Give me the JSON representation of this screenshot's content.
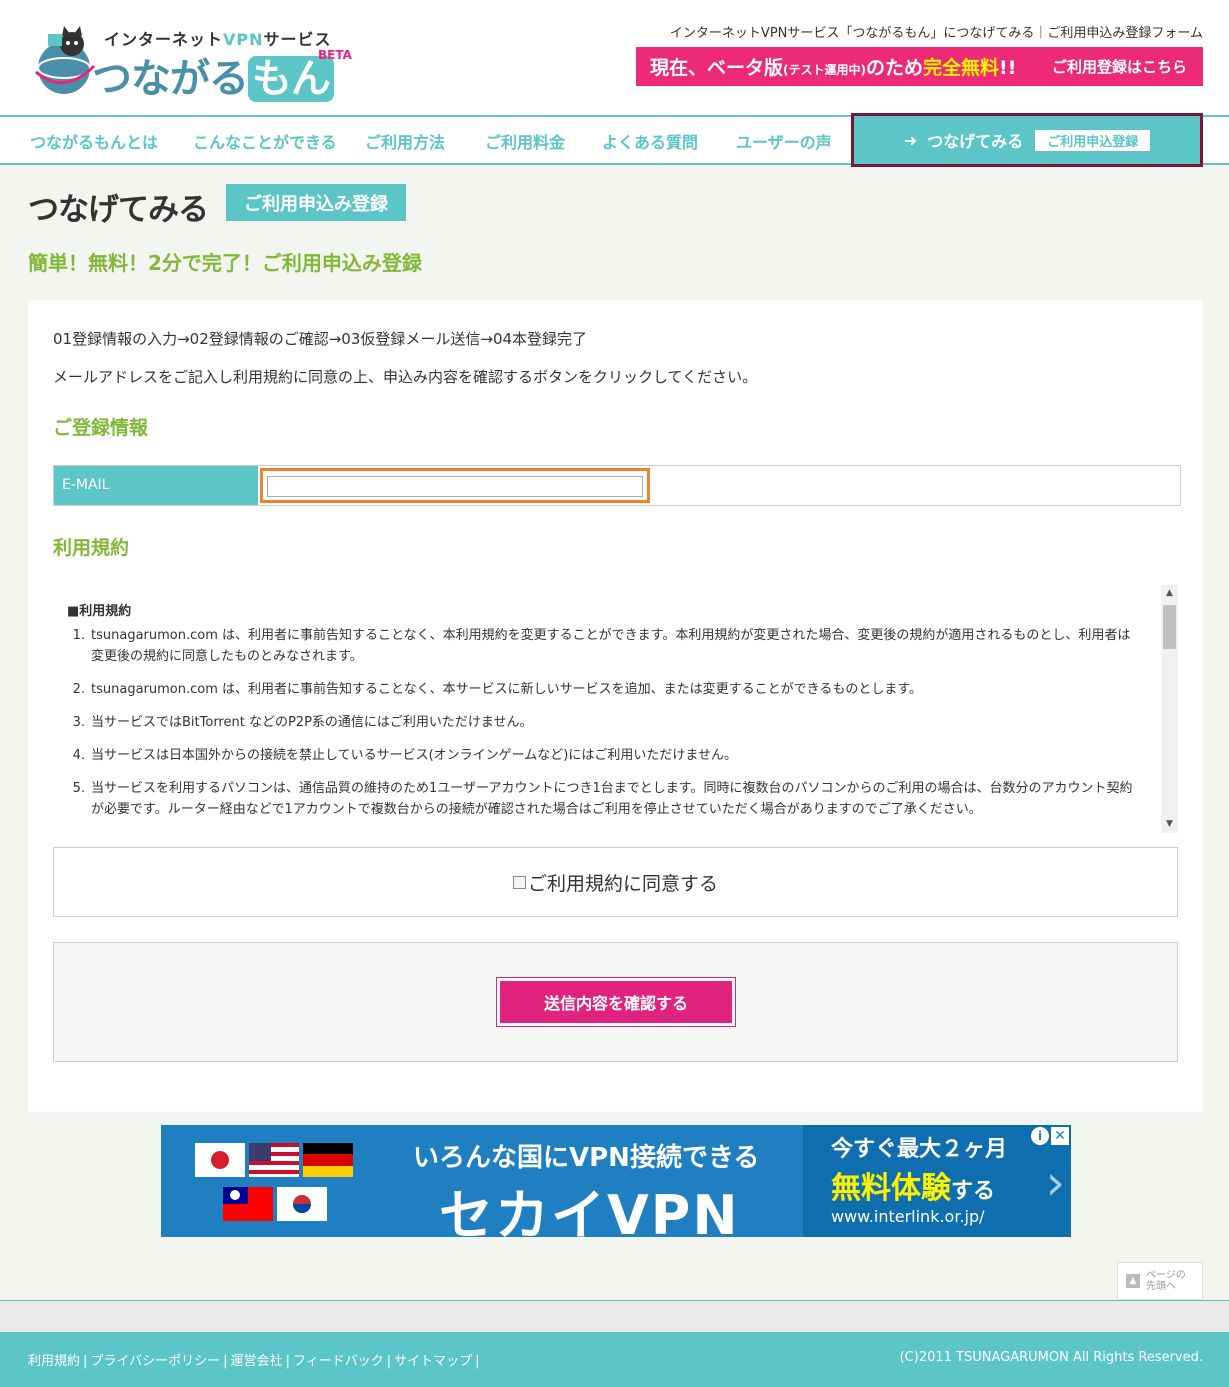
{
  "header": {
    "logo_sub_prefix": "インターネット",
    "logo_sub_vpn": "VPN",
    "logo_sub_suffix": "サービス",
    "logo_main": "つながる",
    "logo_main_mon": "もん",
    "logo_beta": "BETA",
    "breadcrumb": "インターネットVPNサービス「つながるもん」につなげてみる｜ご利用申込み登録フォーム",
    "banner_part1": "現在、ベータ版",
    "banner_small": "(テスト運用中)",
    "banner_part2": "のため",
    "banner_highlight": "完全無料",
    "banner_part3": "!!",
    "banner_cta": "ご利用登録はこちら"
  },
  "nav": {
    "items": [
      "つながるもんとは",
      "こんなことができる",
      "ご利用方法",
      "ご利用料金",
      "よくある質問",
      "ユーザーの声"
    ],
    "cta_label": "つなげてみる",
    "cta_tag": "ご利用申込登録"
  },
  "page": {
    "title": "つなげてみる",
    "title_tag": "ご利用申込み登録",
    "lead": "簡単！無料！2分で完了！ご利用申込み登録"
  },
  "form": {
    "steps": "01登録情報の入力→02登録情報のご確認→03仮登録メール送信→04本登録完了",
    "instruction": "メールアドレスをご記入し利用規約に同意の上、申込み内容を確認するボタンをクリックしてください。",
    "section_registration": "ご登録情報",
    "email_label": "E-MAIL",
    "email_value": "",
    "section_terms": "利用規約",
    "terms_heading": "■利用規約",
    "terms": [
      {
        "num": "1.",
        "text": "tsunagarumon.com は、利用者に事前告知することなく、本利用規約を変更することができます。本利用規約が変更された場合、変更後の規約が適用されるものとし、利用者は変更後の規約に同意したものとみなされます。"
      },
      {
        "num": "2.",
        "text": "tsunagarumon.com は、利用者に事前告知することなく、本サービスに新しいサービスを追加、または変更することができるものとします。"
      },
      {
        "num": "3.",
        "text": "当サービスではBitTorrent などのP2P系の通信にはご利用いただけません。"
      },
      {
        "num": "4.",
        "text": "当サービスは日本国外からの接続を禁止しているサービス(オンラインゲームなど)にはご利用いただけません。"
      },
      {
        "num": "5.",
        "text": "当サービスを利用するパソコンは、通信品質の維持のため1ユーザーアカウントにつき1台までとします。同時に複数台のパソコンからのご利用の場合は、台数分のアカウント契約が必要です。ルーター経由などで1アカウントで複数台からの接続が確認された場合はご利用を停止させていただく場合がありますのでご了承ください。"
      }
    ],
    "agree_label": "ご利用規約に同意する",
    "submit_label": "送信内容を確認する"
  },
  "ad": {
    "line1": "いろんな国にVPN接続できる",
    "line2": "セカイVPN",
    "right1": "今すぐ最大２ヶ月",
    "right2_main": "無料体験",
    "right2_suffix": "する",
    "right3": "www.interlink.or.jp/"
  },
  "to_top": {
    "line1": "ページの",
    "line2": "先頭へ"
  },
  "footer": {
    "links": [
      "利用規約",
      "プライバシーポリシー",
      "運営会社",
      "フィードバック",
      "サイトマップ"
    ],
    "copyright": "(C)2011 TSUNAGARUMON All Rights Reserved."
  },
  "colors": {
    "teal": "#5bc5c7",
    "pink": "#e0247e",
    "green": "#82b838",
    "focus_orange": "#f0822a",
    "cta_border": "#7a1734"
  }
}
